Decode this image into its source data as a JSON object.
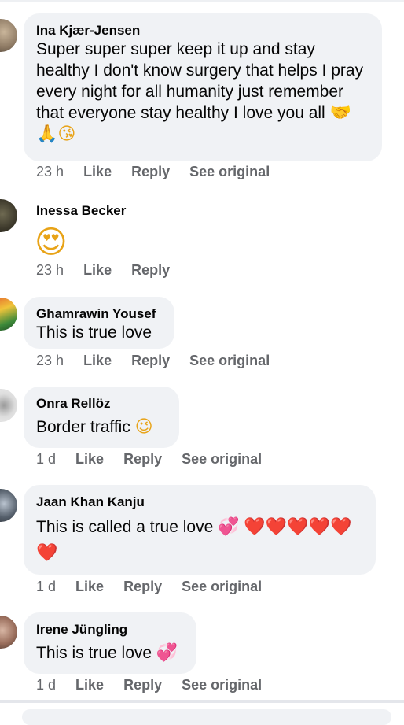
{
  "comments": [
    {
      "author": "Ina Kjær-Jensen",
      "text": "Super super super keep it up and stay healthy I don't know surgery that helps I pray every night for all humanity just remember that everyone stay healthy I love you all",
      "emojis": "🤝🙏😘",
      "time": "23 h",
      "like": "Like",
      "reply": "Reply",
      "see_original": "See original"
    },
    {
      "author": "Inessa Becker",
      "emoji": "😍",
      "time": "23 h",
      "like": "Like",
      "reply": "Reply"
    },
    {
      "author": "Ghamrawin Yousef",
      "text": "This is true love",
      "time": "23 h",
      "like": "Like",
      "reply": "Reply",
      "see_original": "See original"
    },
    {
      "author": "Onra Rellöz",
      "text": "Border traffic",
      "emojis": "😉",
      "time": "1 d",
      "like": "Like",
      "reply": "Reply",
      "see_original": "See original"
    },
    {
      "author": "Jaan Khan Kanju",
      "text": "This is called a true love",
      "emojis": "💞",
      "hearts": "❤️❤️❤️❤️❤️",
      "heart2": "❤️",
      "time": "1 d",
      "like": "Like",
      "reply": "Reply",
      "see_original": "See original"
    },
    {
      "author": "Irene Jüngling",
      "text": "This is true love",
      "emojis": "💞",
      "time": "1 d",
      "like": "Like",
      "reply": "Reply",
      "see_original": "See original"
    }
  ]
}
